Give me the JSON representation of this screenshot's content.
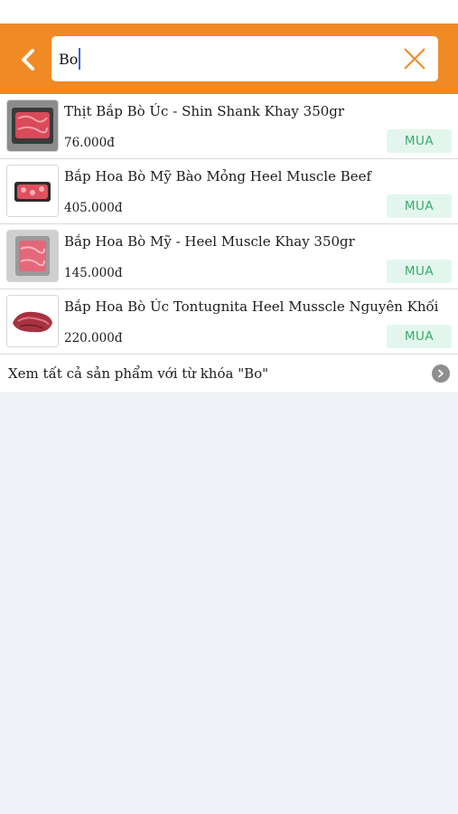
{
  "search": {
    "value": "Bo",
    "placeholder": ""
  },
  "results": [
    {
      "name": "Thịt Bắp Bò Úc - Shin Shank Khay 350gr",
      "price": "76.000đ",
      "buy_label": "MUA",
      "image": "tray-of-beef"
    },
    {
      "name": "Bắp Hoa Bò Mỹ Bào Mỏng Heel Muscle Beef",
      "price": "405.000đ",
      "buy_label": "MUA",
      "image": "sliced-beef-pack"
    },
    {
      "name": "Bắp Hoa Bò Mỹ - Heel Muscle Khay 350gr",
      "price": "145.000đ",
      "buy_label": "MUA",
      "image": "tray-of-beef"
    },
    {
      "name": "Bắp Hoa Bò Úc Tontugnita Heel Musscle Nguyên Khối",
      "price": "220.000đ",
      "buy_label": "MUA",
      "image": "whole-beef-cut"
    }
  ],
  "see_all": {
    "label": "Xem tất cả sản phẩm với từ khóa \"Bo\""
  },
  "colors": {
    "header": "#f08a24",
    "buy_bg": "#e3f6ed",
    "buy_text": "#3aaa6c",
    "page_bg": "#f1f2f7"
  }
}
